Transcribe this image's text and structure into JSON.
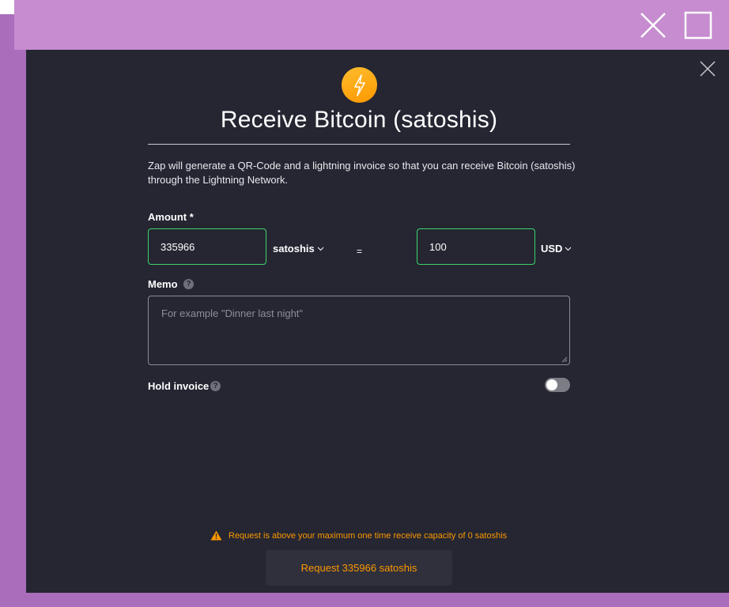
{
  "dialog": {
    "title": "Receive Bitcoin (satoshis)",
    "description": "Zap will generate a QR-Code and a lightning invoice so that you can receive Bitcoin (satoshis) through the Lightning Network."
  },
  "amount": {
    "label": "Amount *",
    "crypto_value": "335966",
    "crypto_unit": "satoshis",
    "equals": "=",
    "fiat_value": "100",
    "fiat_unit": "USD"
  },
  "memo": {
    "label": "Memo",
    "placeholder": "For example \"Dinner last night\"",
    "help": "?"
  },
  "hold_invoice": {
    "label": "Hold invoice",
    "help": "?",
    "enabled": false
  },
  "warning": {
    "text": "Request is above your maximum one time receive capacity of 0 satoshis"
  },
  "request_button": {
    "label": "Request 335966 satoshis"
  },
  "colors": {
    "background": "#252632",
    "accent": "#fd9800",
    "valid_border": "#3fd36b",
    "frame_purple": "#a96dbc"
  },
  "icons": [
    "close-icon",
    "maximize-icon",
    "lightning-bolt-icon",
    "chevron-down-icon",
    "help-icon",
    "warning-icon"
  ]
}
